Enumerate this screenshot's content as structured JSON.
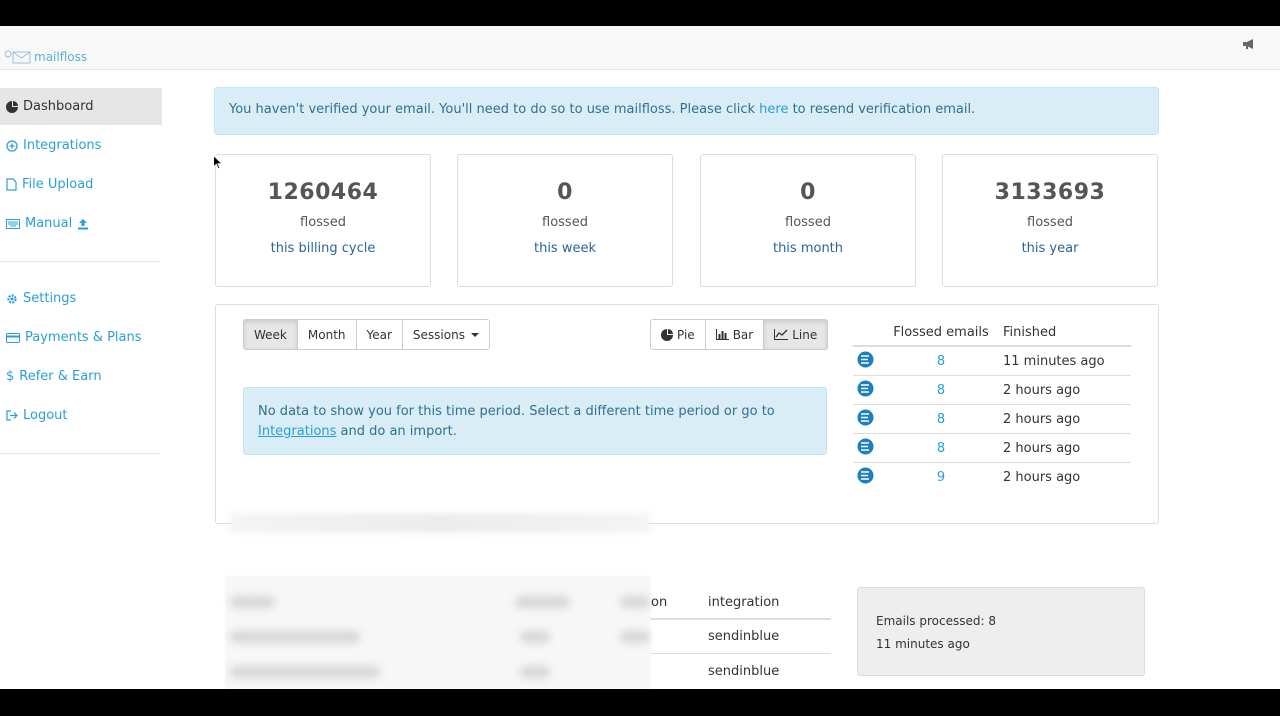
{
  "brand": {
    "name": "mailfloss"
  },
  "sidebar": {
    "items": [
      {
        "label": "Dashboard",
        "icon": "pie-chart-icon",
        "active": true
      },
      {
        "label": "Integrations",
        "icon": "plus-circle-icon"
      },
      {
        "label": "File Upload",
        "icon": "file-icon"
      },
      {
        "label": "Manual",
        "icon": "keyboard-icon",
        "suffix_icon": "upload-icon"
      },
      {
        "label": "Settings",
        "icon": "gear-icon"
      },
      {
        "label": "Payments & Plans",
        "icon": "credit-card-icon"
      },
      {
        "label": "Refer & Earn",
        "icon": "dollar-icon"
      },
      {
        "label": "Logout",
        "icon": "logout-icon"
      }
    ]
  },
  "alert": {
    "text_before": "You haven't verified your email. You'll need to do so to use mailfloss. Please click ",
    "link": "here",
    "text_after": " to resend verification email."
  },
  "stats": [
    {
      "value": "1260464",
      "label": "flossed",
      "period": "this billing cycle"
    },
    {
      "value": "0",
      "label": "flossed",
      "period": "this week"
    },
    {
      "value": "0",
      "label": "flossed",
      "period": "this month"
    },
    {
      "value": "3133693",
      "label": "flossed",
      "period": "this year"
    }
  ],
  "period_buttons": {
    "week": "Week",
    "month": "Month",
    "year": "Year",
    "sessions": "Sessions"
  },
  "chart_buttons": {
    "pie": "Pie",
    "bar": "Bar",
    "line": "Line"
  },
  "nodata": {
    "text_before": "No data to show you for this time period. Select a different time period or go to ",
    "link": "Integrations",
    "text_after": " and do an import."
  },
  "recent": {
    "headers": {
      "emails": "Flossed emails",
      "finished": "Finished"
    },
    "rows": [
      {
        "emails": "8",
        "finished": "11 minutes ago"
      },
      {
        "emails": "8",
        "finished": "2 hours ago"
      },
      {
        "emails": "8",
        "finished": "2 hours ago"
      },
      {
        "emails": "8",
        "finished": "2 hours ago"
      },
      {
        "emails": "9",
        "finished": "2 hours ago"
      }
    ]
  },
  "integrations_table": {
    "headers": {
      "partial": "on",
      "integration": "integration"
    },
    "rows": [
      {
        "integration": "sendinblue"
      },
      {
        "integration": "sendinblue"
      }
    ]
  },
  "info": {
    "processed": "Emails processed: 8",
    "time": "11 minutes ago"
  },
  "colors": {
    "link": "#2a9fd6",
    "alert_bg": "#d9edf7",
    "alert_text": "#31708f",
    "active_bg": "#e6e6e6"
  }
}
